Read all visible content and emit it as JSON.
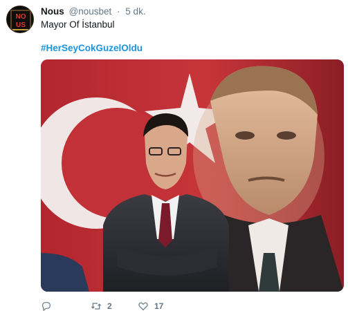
{
  "tweet": {
    "author": {
      "display_name": "Nous",
      "handle": "@nousbet",
      "separator": "·",
      "time": "5 dk.",
      "avatar_text_top": "NO",
      "avatar_text_bottom": "US"
    },
    "text": "Mayor Of İstanbul",
    "hashtag": "#HerSeyCokGuzelOldu",
    "media": {
      "kind": "photo",
      "icon": "photo-portrait"
    },
    "actions": {
      "reply_icon": "reply-icon",
      "retweet_icon": "retweet-icon",
      "retweet_count": "2",
      "like_icon": "heart-icon",
      "like_count": "17"
    }
  },
  "colors": {
    "link": "#1b95e0",
    "secondary_text": "#657786",
    "primary_text": "#14171a",
    "flag_red": "#b8242c"
  }
}
